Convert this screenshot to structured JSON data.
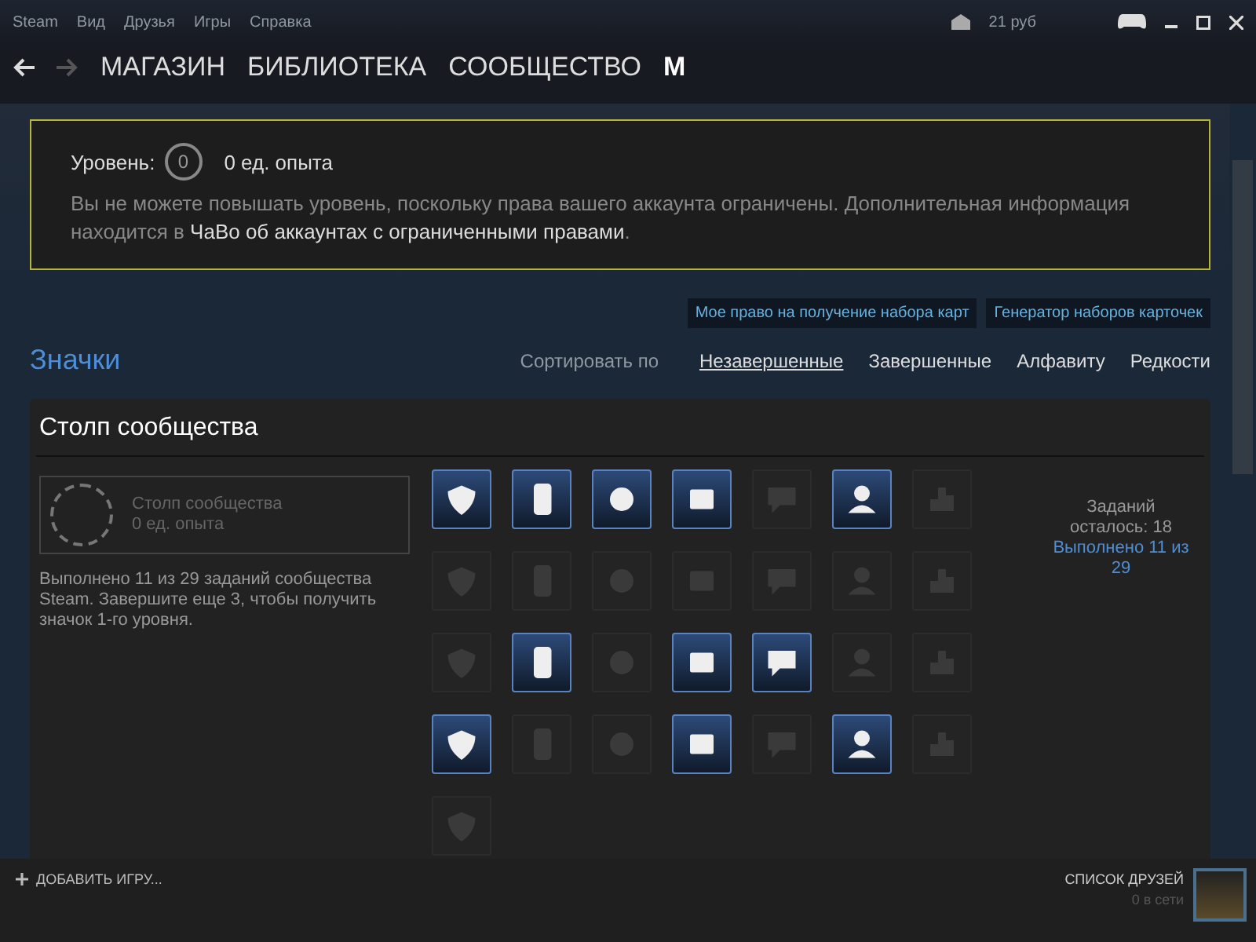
{
  "menu": [
    "Steam",
    "Вид",
    "Друзья",
    "Игры",
    "Справка"
  ],
  "wallet": "21 руб",
  "nav": {
    "back_enabled": true,
    "forward_enabled": false,
    "items": [
      "МАГАЗИН",
      "БИБЛИОТЕКА",
      "СООБЩЕСТВО",
      "M"
    ]
  },
  "level_box": {
    "label": "Уровень:",
    "level": "0",
    "xp": "0 ед. опыта",
    "notice_before": "Вы не можете повышать уровень, поскольку права вашего аккаунта ограничены. Дополнительная информация находится в ",
    "notice_link": "ЧаВо об аккаунтах с ограниченными правами",
    "notice_after": "."
  },
  "buttons": [
    "Мое право на получение набора карт",
    "Генератор наборов карточек"
  ],
  "badges_title": "Значки",
  "sort": {
    "label": "Сортировать по",
    "options": [
      {
        "label": "Незавершенные",
        "selected": true
      },
      {
        "label": "Завершенные",
        "selected": false
      },
      {
        "label": "Алфавиту",
        "selected": false
      },
      {
        "label": "Редкости",
        "selected": false
      }
    ]
  },
  "badge_panel": {
    "title": "Столп сообщества",
    "badge_name": "Столп сообщества",
    "badge_xp": "0 ед. опыта",
    "description": "Выполнено 11 из 29 заданий сообщества Steam. Завершите еще 3, чтобы получить значок 1-го уровня.",
    "remaining": "Заданий осталось: 18",
    "done": "Выполнено 11 из 29",
    "tasks": [
      {
        "earned": true
      },
      {
        "earned": true
      },
      {
        "earned": true
      },
      {
        "earned": true
      },
      {
        "earned": false
      },
      {
        "earned": true
      },
      {
        "earned": false
      },
      {
        "earned": false
      },
      {
        "earned": false
      },
      {
        "earned": false
      },
      {
        "earned": false
      },
      {
        "earned": false
      },
      {
        "earned": false
      },
      {
        "earned": false
      },
      {
        "earned": false
      },
      {
        "earned": true
      },
      {
        "earned": false
      },
      {
        "earned": true
      },
      {
        "earned": true
      },
      {
        "earned": false
      },
      {
        "earned": false
      },
      {
        "earned": true
      },
      {
        "earned": false
      },
      {
        "earned": false
      },
      {
        "earned": true
      },
      {
        "earned": false
      },
      {
        "earned": true
      },
      {
        "earned": false
      },
      {
        "earned": false
      }
    ]
  },
  "footer": {
    "add_game": "ДОБАВИТЬ ИГРУ...",
    "friends": "СПИСОК ДРУЗЕЙ",
    "online": "0 в сети"
  }
}
